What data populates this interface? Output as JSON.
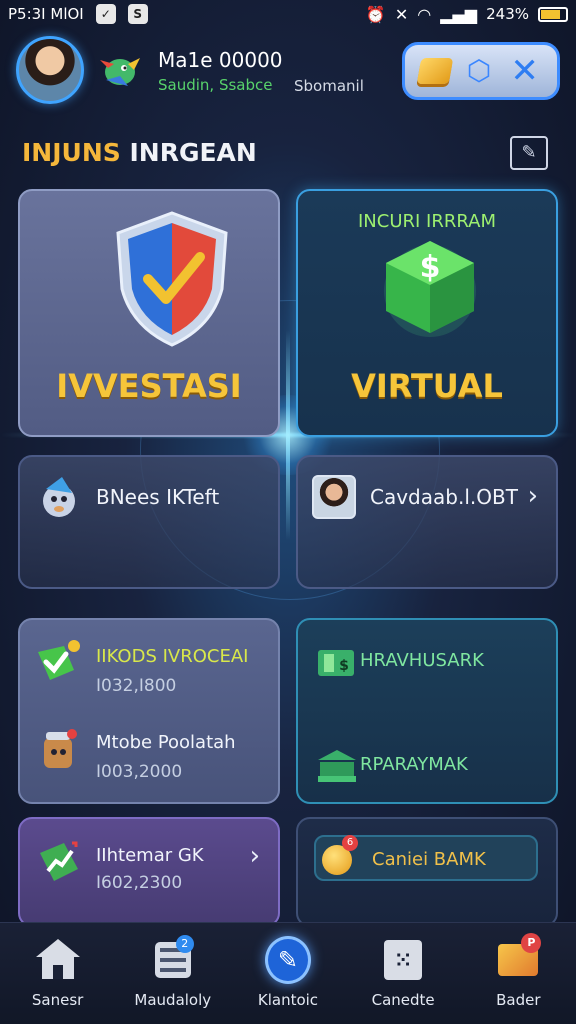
{
  "status_bar": {
    "time": "P5:3I MlOI",
    "battery": "243%"
  },
  "header": {
    "user_name": "Ma1e 00000",
    "user_sub": "Saudin, Ssabce",
    "user_role": "Sbomanil"
  },
  "section": {
    "title_part1": "INJUNS",
    "title_part2": "INRGEAN"
  },
  "cards": {
    "invest_label": "IVVESTASI",
    "virtual_top": "INCURI IRRRAM",
    "virtual_label": "VIRTUAL",
    "mid_left_label": "BNees IKTeft",
    "mid_right_label": "Cavdaab.l.OBT",
    "list_left": [
      {
        "title": "IIKODS IVROCEAI",
        "value": "I032,I800",
        "title_color": "#d9e84a"
      },
      {
        "title": "Mtobe Poolatah",
        "value": "I003,2000",
        "title_color": "#f1f4fb"
      }
    ],
    "list_right": [
      {
        "title": "HRAVHUSARK"
      },
      {
        "title": "RPARAYMAK"
      }
    ],
    "bottom_left_title": "IIhtemar GK",
    "bottom_left_value": "I602,2300",
    "bottom_right_label": "Caniei BAMK",
    "coin_badge": "6"
  },
  "nav": [
    {
      "label": "Sanesr",
      "icon": "home-icon"
    },
    {
      "label": "Maudaloly",
      "icon": "list-icon",
      "badge": "2"
    },
    {
      "label": "Klantoic",
      "icon": "edit-icon"
    },
    {
      "label": "Canedte",
      "icon": "calculator-icon"
    },
    {
      "label": "Bader",
      "icon": "mail-icon",
      "badge": "P"
    }
  ],
  "colors": {
    "accent_blue": "#3d8cff",
    "gold": "#f6c53a",
    "green": "#58d36b"
  }
}
